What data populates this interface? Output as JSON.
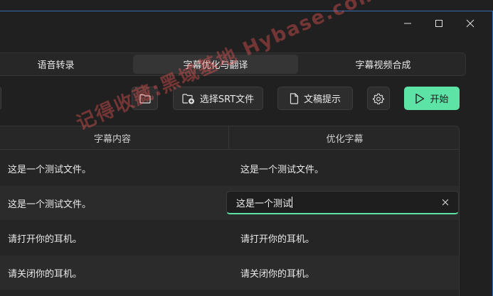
{
  "tabs": [
    {
      "label": "语音转录"
    },
    {
      "label": "字幕优化与翻译"
    },
    {
      "label": "字幕视频合成"
    }
  ],
  "active_tab": "字幕优化与翻译",
  "toolbar": {
    "select_srt_label": "选择SRT文件",
    "prompt_label": "文稿提示",
    "start_label": "开始"
  },
  "table": {
    "headers": [
      "字幕内容",
      "优化字幕"
    ],
    "rows": [
      {
        "original": "这是一个测试文件。",
        "optimized": "这是一个测试文件。"
      },
      {
        "original": "这是一个测试文件。",
        "optimized": "这是一个测试"
      },
      {
        "original": "请打开你的耳机。",
        "optimized": "请打开你的耳机。"
      },
      {
        "original": "请关闭你的耳机。",
        "optimized": "请关闭你的耳机。"
      }
    ]
  },
  "watermark": "记得收藏:黑域基地 Hybase.com",
  "colors": {
    "accent": "#5de3a6",
    "background": "#202020"
  }
}
